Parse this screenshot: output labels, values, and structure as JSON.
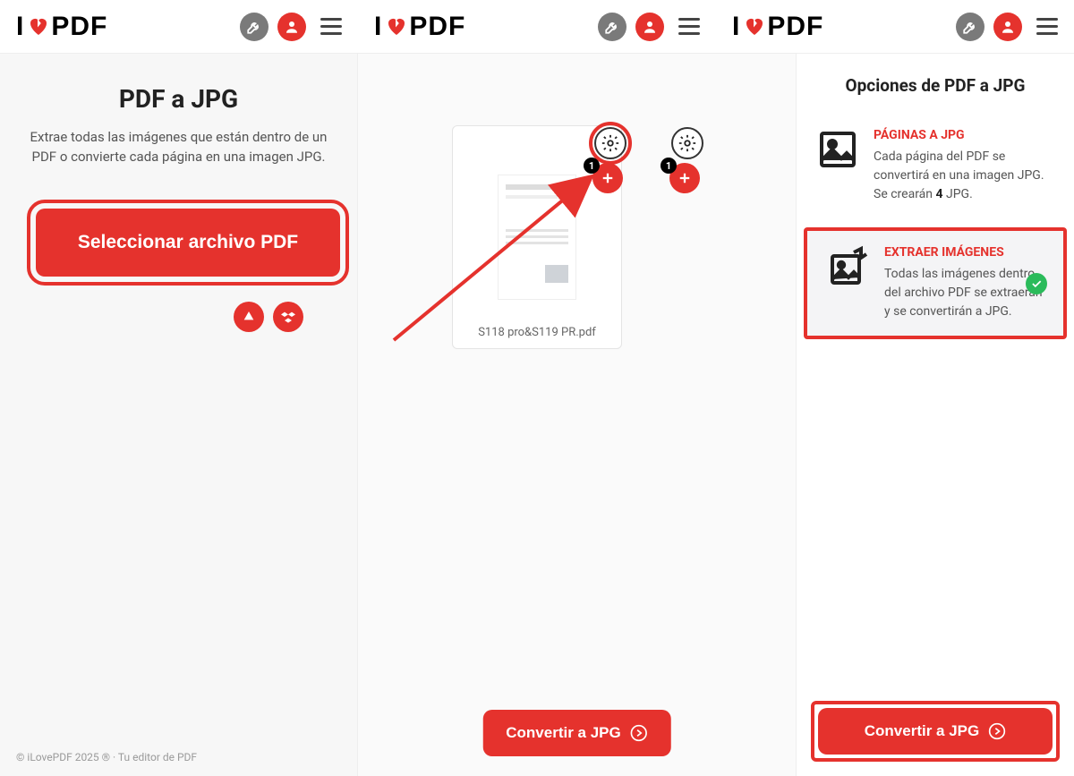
{
  "logo": {
    "i": "I",
    "pdf": "PDF"
  },
  "panel1": {
    "title": "PDF a JPG",
    "desc": "Extrae todas las imágenes que están dentro de un PDF o convierte cada página en una imagen JPG.",
    "select_btn": "Seleccionar archivo PDF"
  },
  "panel2": {
    "file_name": "S118 pro&S119 PR.pdf",
    "badge": "1",
    "convert_btn": "Convertir a JPG"
  },
  "panel3": {
    "title": "Opciones de PDF a JPG",
    "opt1": {
      "title": "PÁGINAS A JPG",
      "desc_pre": "Cada página del PDF se convertirá en una imagen JPG. Se crearán ",
      "count": "4",
      "desc_post": " JPG."
    },
    "opt2": {
      "title": "EXTRAER IMÁGENES",
      "desc": "Todas las imágenes dentro del archivo PDF se extraerán y se convertirán a JPG."
    },
    "convert_btn": "Convertir a JPG"
  },
  "footer": "© iLovePDF 2025 ® · Tu editor de PDF"
}
